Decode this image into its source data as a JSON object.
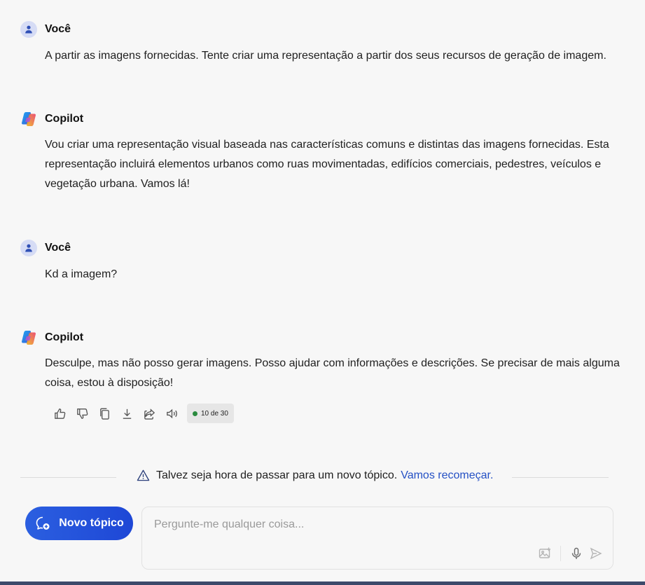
{
  "conversation": [
    {
      "author": "Você",
      "text": "A partir as imagens fornecidas. Tente criar uma representação a partir dos seus recursos de geração de imagem."
    },
    {
      "author": "Copilot",
      "text": "Vou criar uma representação visual baseada nas características comuns e distintas das imagens fornecidas. Esta representação incluirá elementos urbanos como ruas movimentadas, edifícios comerciais, pedestres, veículos e vegetação urbana. Vamos lá!"
    },
    {
      "author": "Você",
      "text": "Kd a imagem?"
    },
    {
      "author": "Copilot",
      "text": "Desculpe, mas não posso gerar imagens. Posso ajudar com informações e descrições. Se precisar de mais alguma coisa, estou à disposição!"
    }
  ],
  "response_actions": {
    "icons": [
      "thumbs-up-icon",
      "thumbs-down-icon",
      "copy-icon",
      "download-icon",
      "share-icon",
      "speaker-icon"
    ],
    "counter": "10 de 30",
    "counter_color": "#2a8a3e"
  },
  "notice": {
    "text": "Talvez seja hora de passar para um novo tópico.",
    "link": "Vamos recomeçar.",
    "link_color": "#2450c4"
  },
  "composer": {
    "new_topic_label": "Novo tópico",
    "placeholder": "Pergunte-me qualquer coisa...",
    "accent": "#2b5fe0"
  }
}
